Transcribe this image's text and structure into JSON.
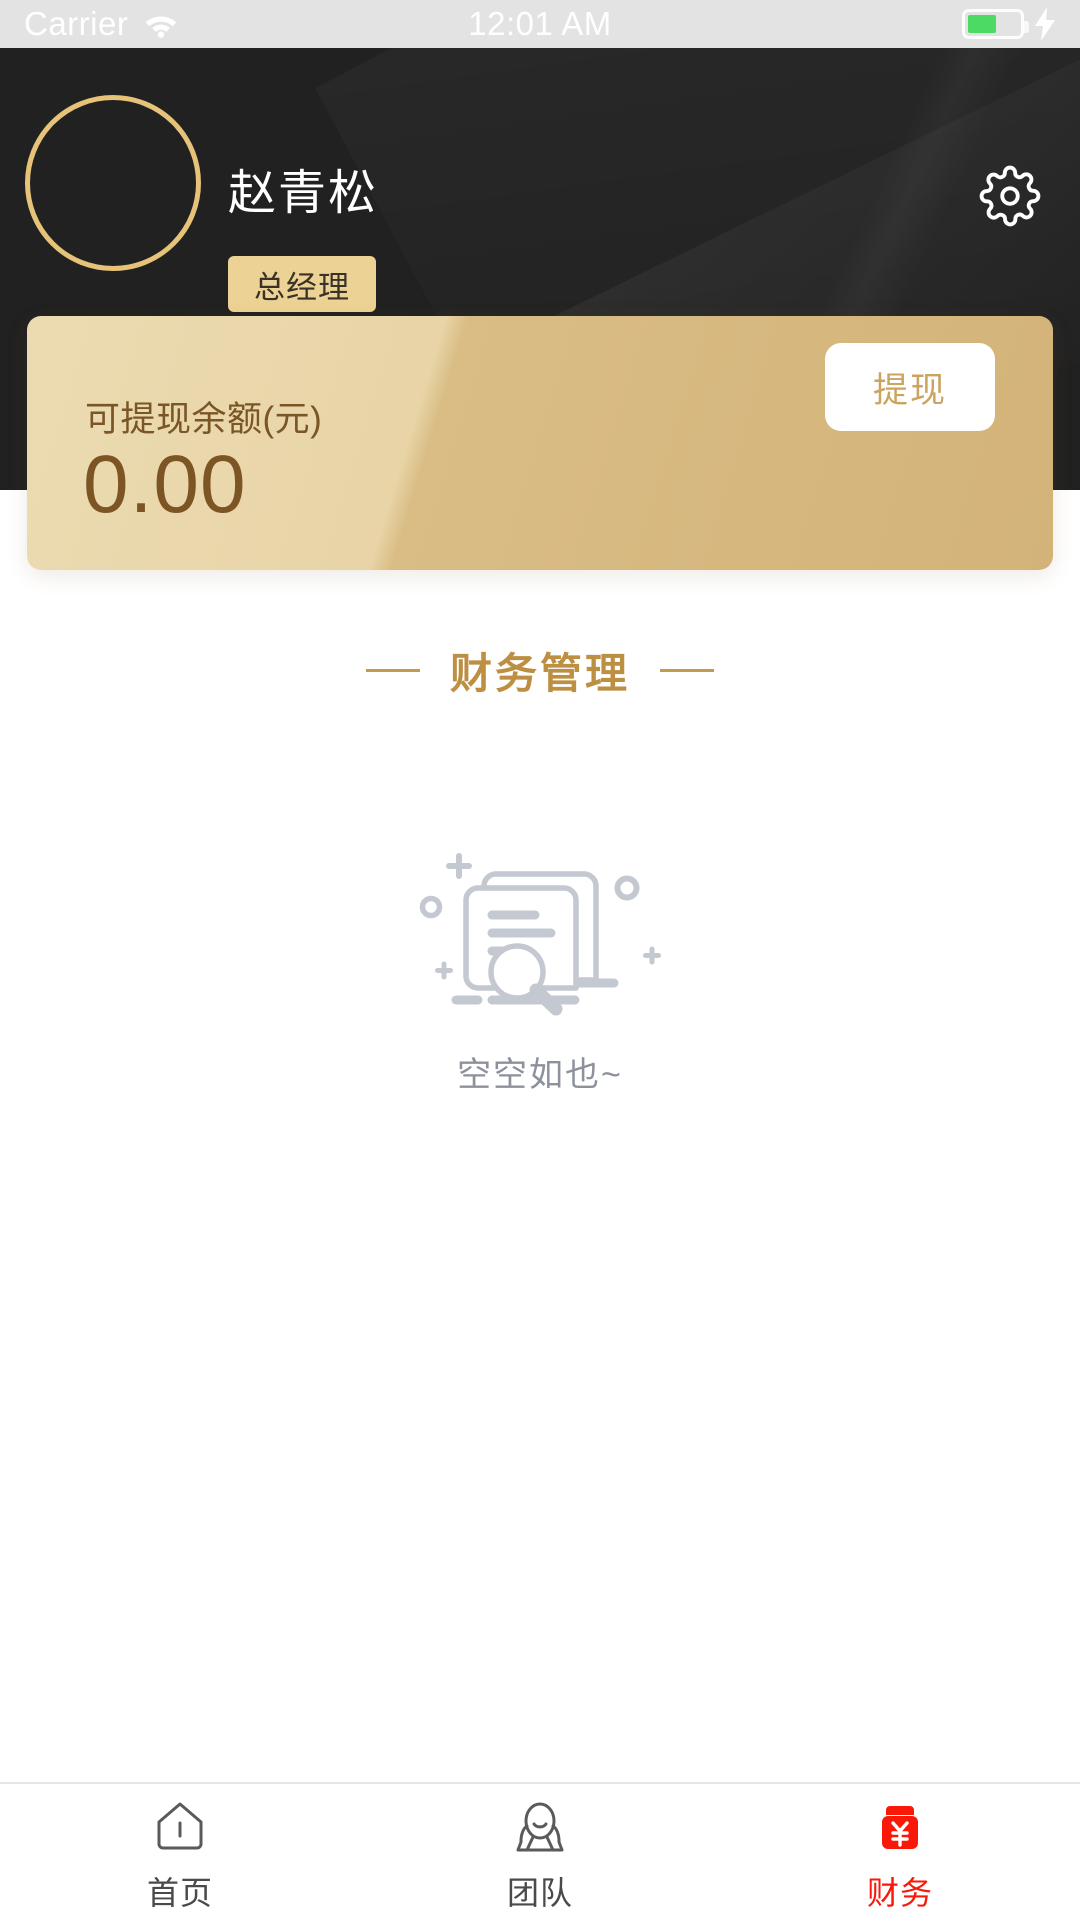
{
  "statusbar": {
    "carrier": "Carrier",
    "time": "12:01 AM",
    "wifi_icon": "wifi-icon",
    "battery_icon": "battery-icon",
    "charging_icon": "lightning-bolt-icon",
    "battery_level_percent": 55
  },
  "header": {
    "avatar_icon": "avatar-placeholder",
    "name": "赵青松",
    "role_badge": "总经理",
    "settings_icon": "gear-icon",
    "background_color": "#212121",
    "accent_color": "#e7c379"
  },
  "balance_card": {
    "label": "可提现余额(元)",
    "amount": "0.00",
    "withdraw_label": "提现",
    "gradient_start": "#ecdbb2",
    "gradient_end": "#d3b379",
    "text_color": "#7d5524"
  },
  "section": {
    "title": "财务管理",
    "accent_color": "#bd8f42"
  },
  "empty_state": {
    "illustration_icon": "empty-documents-search-icon",
    "message": "空空如也~",
    "color": "#c3c8d1"
  },
  "tabbar": {
    "active_color": "#fa1808",
    "inactive_color": "#4a4a4a",
    "items": [
      {
        "label": "首页",
        "icon": "home-icon",
        "active": false
      },
      {
        "label": "团队",
        "icon": "team-icon",
        "active": false
      },
      {
        "label": "财务",
        "icon": "finance-wallet-icon",
        "active": true
      }
    ]
  }
}
